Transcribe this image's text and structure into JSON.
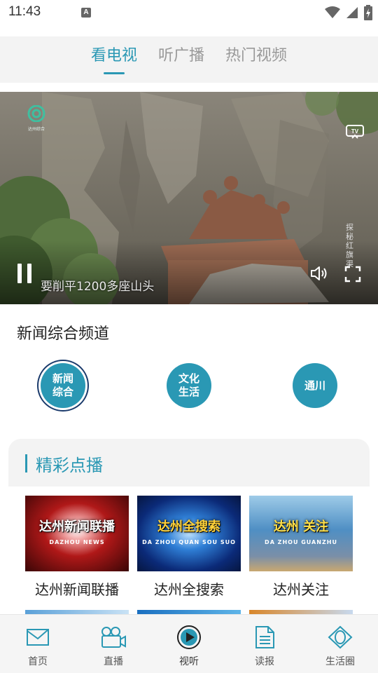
{
  "status_bar": {
    "time": "11:43",
    "notification_letter": "A"
  },
  "top_tabs": [
    {
      "label": "看电视",
      "active": true
    },
    {
      "label": "听广播",
      "active": false
    },
    {
      "label": "热门视频",
      "active": false
    }
  ],
  "player": {
    "subtitle": "要削平1200多座山头",
    "logo_caption": "达州综合",
    "tv_badge": "TV",
    "side_caption": "探秘红旗渠"
  },
  "channel": {
    "title": "新闻综合频道",
    "buttons": [
      {
        "label": "新闻综合",
        "active": true
      },
      {
        "label": "文化生活",
        "active": false
      },
      {
        "label": "通川",
        "active": false
      }
    ]
  },
  "vod": {
    "title": "精彩点播",
    "items": [
      {
        "label": "达州新闻联播",
        "thumb_title": "达州新闻联播",
        "thumb_sub": "DAZHOU NEWS"
      },
      {
        "label": "达州全搜索",
        "thumb_title": "达州全搜索",
        "thumb_sub": "DA ZHOU QUAN SOU SUO"
      },
      {
        "label": "达州关注",
        "thumb_title": "达州 关注",
        "thumb_sub": "DA ZHOU GUANZHU"
      }
    ]
  },
  "bottom_nav": [
    {
      "label": "首页",
      "icon": "mail-icon"
    },
    {
      "label": "直播",
      "icon": "video-camera-icon"
    },
    {
      "label": "视听",
      "icon": "play-circle-icon",
      "active": true
    },
    {
      "label": "读报",
      "icon": "document-icon"
    },
    {
      "label": "生活圈",
      "icon": "eye-diamond-icon"
    }
  ],
  "colors": {
    "accent": "#2a98b4",
    "active_ring": "#1a3a6b"
  }
}
